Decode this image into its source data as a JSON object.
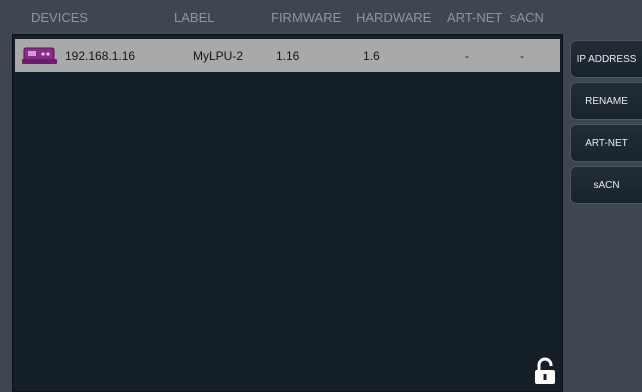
{
  "columns": {
    "devices": "DEVICES",
    "label": "LABEL",
    "firmware": "FIRMWARE",
    "hardware": "HARDWARE",
    "artnet": "ART-NET",
    "sacn": "sACN"
  },
  "devices": [
    {
      "ip": "192.168.1.16",
      "label": "MyLPU-2",
      "firmware": "1.16",
      "hardware": "1.6",
      "artnet": "-",
      "sacn": "-",
      "icon": "device-icon"
    }
  ],
  "actions": {
    "ip_address": "IP ADDRESS",
    "rename": "RENAME",
    "artnet": "ART-NET",
    "sacn": "sACN"
  },
  "lock_icon": "padlock-unlocked-icon",
  "colors": {
    "background": "#3e474f",
    "panel": "#151f28",
    "selected_row": "#a7a9aa",
    "header_text": "#8e969c",
    "button_text": "#e8ecef"
  }
}
